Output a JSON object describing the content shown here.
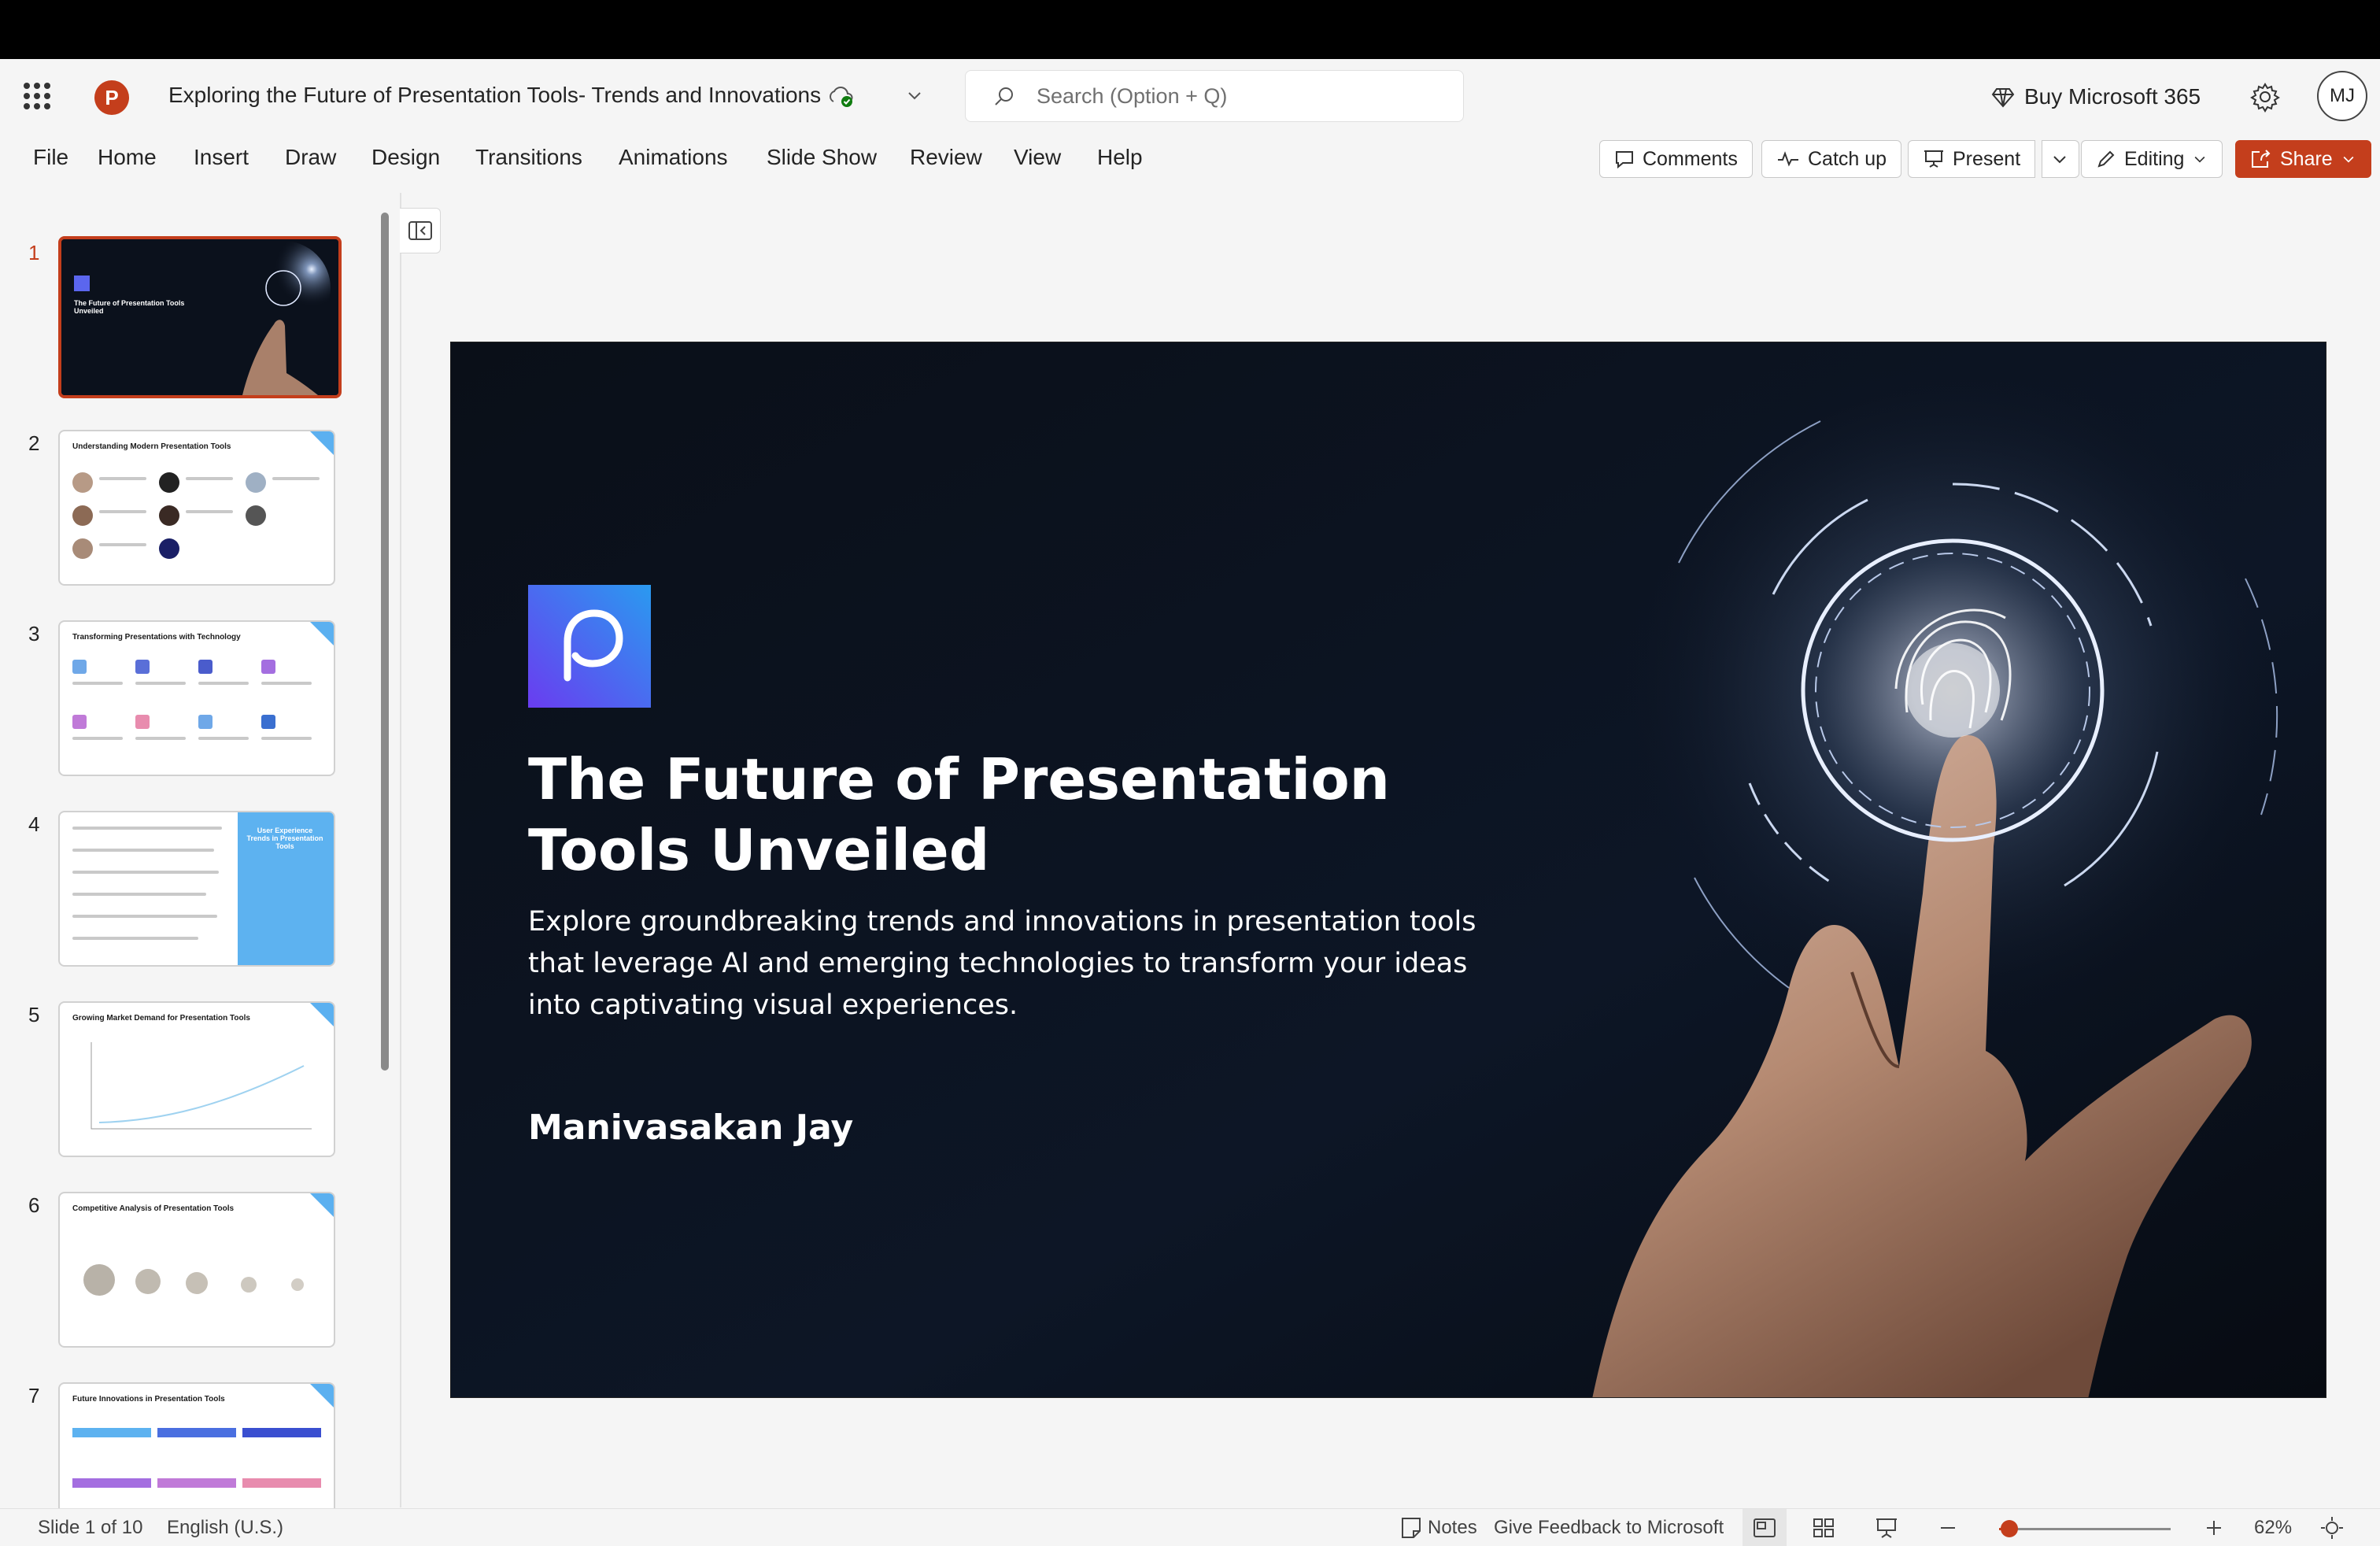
{
  "app": {
    "doc_title": "Exploring the Future of Presentation Tools- Trends and Innovations",
    "search_placeholder": "Search (Option + Q)",
    "buy_label": "Buy Microsoft 365",
    "avatar_initials": "MJ",
    "brand_color": "#c43e1c"
  },
  "ribbon": {
    "tabs": [
      "File",
      "Home",
      "Insert",
      "Draw",
      "Design",
      "Transitions",
      "Animations",
      "Slide Show",
      "Review",
      "View",
      "Help"
    ],
    "comments": "Comments",
    "catch_up": "Catch up",
    "present": "Present",
    "editing": "Editing",
    "share": "Share"
  },
  "thumbnails": [
    {
      "num": "1",
      "title": "The Future of Presentation Tools Unveiled",
      "active": true
    },
    {
      "num": "2",
      "title": "Understanding Modern Presentation Tools"
    },
    {
      "num": "3",
      "title": "Transforming Presentations with Technology"
    },
    {
      "num": "4",
      "title": "User Experience Trends in Presentation Tools"
    },
    {
      "num": "5",
      "title": "Growing Market Demand for Presentation Tools"
    },
    {
      "num": "6",
      "title": "Competitive Analysis of Presentation Tools"
    },
    {
      "num": "7",
      "title": "Future Innovations in Presentation Tools"
    }
  ],
  "slide": {
    "title": "The Future of Presentation Tools Unveiled",
    "subtitle": "Explore groundbreaking trends and innovations in presentation tools that leverage AI and emerging technologies to transform your ideas into captivating visual experiences.",
    "author": "Manivasakan  Jay"
  },
  "status": {
    "slide_count": "Slide 1 of 10",
    "language": "English (U.S.)",
    "notes": "Notes",
    "feedback": "Give Feedback to Microsoft",
    "zoom": "62%",
    "zoom_level": 0.06
  }
}
